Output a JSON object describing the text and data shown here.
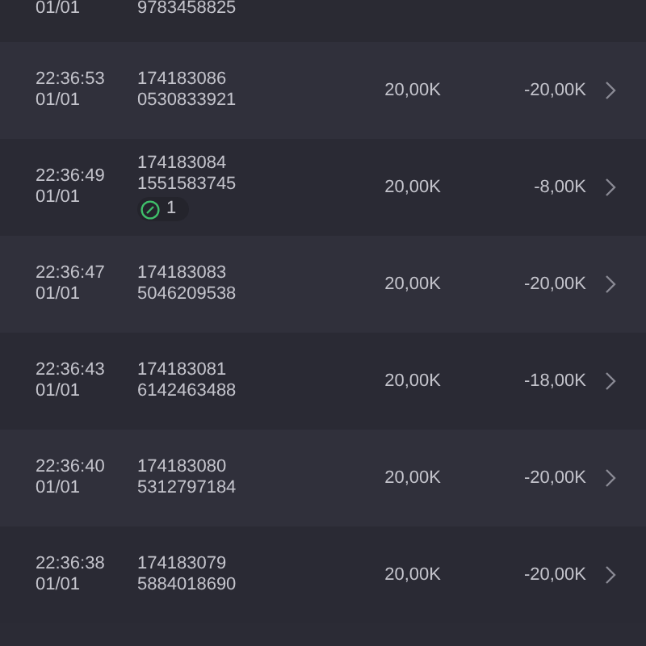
{
  "partial_row": {
    "date": "01/01",
    "account": "9783458825"
  },
  "rows": [
    {
      "time": "22:36:53",
      "date": "01/01",
      "id": "174183086",
      "account": "0530833921",
      "amount": "20,00K",
      "result": "-20,00K"
    },
    {
      "time": "22:36:49",
      "date": "01/01",
      "id": "174183084",
      "account": "1551583745",
      "badge": "1",
      "amount": "20,00K",
      "result": "-8,00K"
    },
    {
      "time": "22:36:47",
      "date": "01/01",
      "id": "174183083",
      "account": "5046209538",
      "amount": "20,00K",
      "result": "-20,00K"
    },
    {
      "time": "22:36:43",
      "date": "01/01",
      "id": "174183081",
      "account": "6142463488",
      "amount": "20,00K",
      "result": "-18,00K"
    },
    {
      "time": "22:36:40",
      "date": "01/01",
      "id": "174183080",
      "account": "5312797184",
      "amount": "20,00K",
      "result": "-20,00K"
    },
    {
      "time": "22:36:38",
      "date": "01/01",
      "id": "174183079",
      "account": "5884018690",
      "amount": "20,00K",
      "result": "-20,00K"
    }
  ]
}
